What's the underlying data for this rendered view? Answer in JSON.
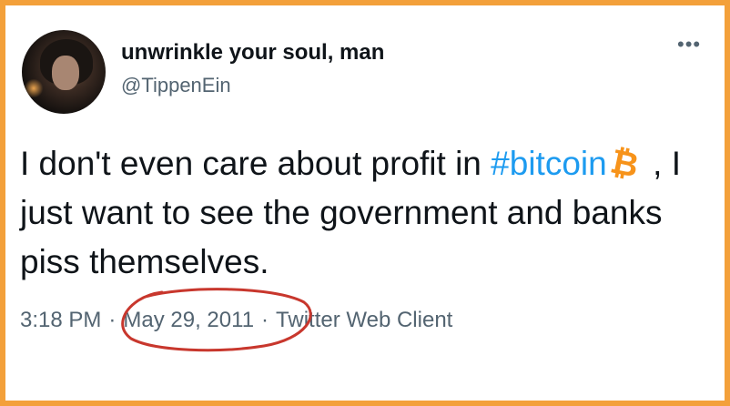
{
  "tweet": {
    "display_name": "unwrinkle your soul, man",
    "handle": "@TippenEin",
    "more_icon": "more-options-icon",
    "text_before": "I don't even care about profit in ",
    "hashtag": "#bitcoin",
    "bitcoin_symbol": "₿",
    "text_after": " , I just want to see the government and banks piss themselves.",
    "time": "3:18 PM",
    "separator": "·",
    "date": "May 29, 2011",
    "source": "Twitter Web Client"
  },
  "colors": {
    "border": "#f3a03a",
    "link": "#1d9bf0",
    "annotation": "#c8372d"
  }
}
